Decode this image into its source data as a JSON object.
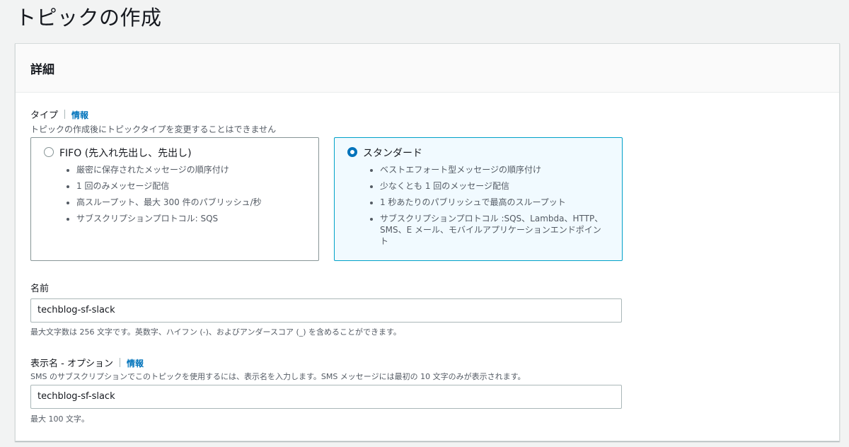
{
  "page": {
    "title": "トピックの作成"
  },
  "panel": {
    "title": "詳細"
  },
  "type_section": {
    "label": "タイプ",
    "info": "情報",
    "description": "トピックの作成後にトピックタイプを変更することはできません",
    "options": [
      {
        "title": "FIFO (先入れ先出し、先出し)",
        "selected": false,
        "bullets": [
          "厳密に保存されたメッセージの順序付け",
          "1 回のみメッセージ配信",
          "高スループット、最大 300 件のパブリッシュ/秒",
          "サブスクリプションプロトコル: SQS"
        ]
      },
      {
        "title": "スタンダード",
        "selected": true,
        "bullets": [
          "ベストエフォート型メッセージの順序付け",
          "少なくとも 1 回のメッセージ配信",
          "1 秒あたりのパブリッシュで最高のスループット",
          "サブスクリプションプロトコル :SQS、Lambda、HTTP、SMS、E メール、モバイルアプリケーションエンドポイント"
        ]
      }
    ]
  },
  "name_field": {
    "label": "名前",
    "value": "techblog-sf-slack",
    "hint": "最大文字数は 256 文字です。英数字、ハイフン (-)、およびアンダースコア (_) を含めることができます。"
  },
  "display_name_field": {
    "label": "表示名 - オプション",
    "info": "情報",
    "description": "SMS のサブスクリプションでこのトピックを使用するには、表示名を入力します。SMS メッセージには最初の 10 文字のみが表示されます。",
    "value": "techblog-sf-slack",
    "hint": "最大 100 文字。"
  }
}
